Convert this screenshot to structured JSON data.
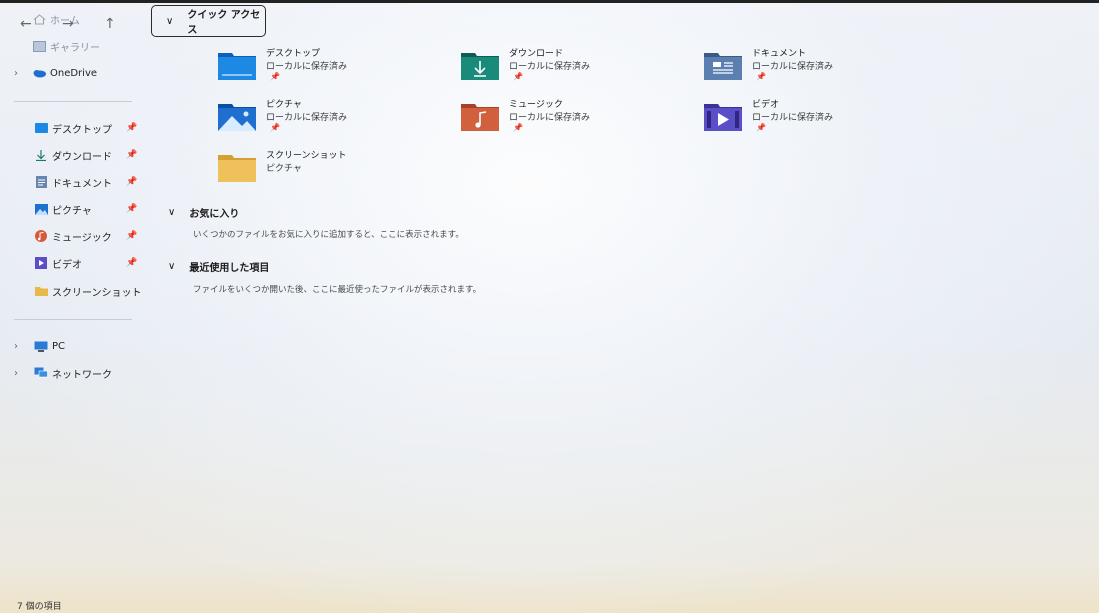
{
  "sidebar": {
    "home": "ホーム",
    "gallery": "ギャラリー",
    "onedrive": "OneDrive",
    "pinned": [
      {
        "label": "デスクトップ",
        "icon": "desktop-folder-icon",
        "pinned": true
      },
      {
        "label": "ダウンロード",
        "icon": "download-icon",
        "pinned": true
      },
      {
        "label": "ドキュメント",
        "icon": "document-icon",
        "pinned": true
      },
      {
        "label": "ピクチャ",
        "icon": "pictures-icon",
        "pinned": true
      },
      {
        "label": "ミュージック",
        "icon": "music-icon",
        "pinned": true
      },
      {
        "label": "ビデオ",
        "icon": "video-icon",
        "pinned": true
      },
      {
        "label": "スクリーンショット",
        "icon": "folder-icon",
        "pinned": false
      }
    ],
    "pc": "PC",
    "network": "ネットワーク"
  },
  "quick_access": {
    "title": "クイック アクセス",
    "items": [
      {
        "name": "デスクトップ",
        "location": "ローカルに保存済み",
        "pinned": true,
        "icon": "desktop-folder-icon",
        "color": "#1e88e5"
      },
      {
        "name": "ダウンロード",
        "location": "ローカルに保存済み",
        "pinned": true,
        "icon": "download-folder-icon",
        "color": "#1a8a7a"
      },
      {
        "name": "ドキュメント",
        "location": "ローカルに保存済み",
        "pinned": true,
        "icon": "documents-folder-icon",
        "color": "#5a7fb0"
      },
      {
        "name": "ピクチャ",
        "location": "ローカルに保存済み",
        "pinned": true,
        "icon": "pictures-folder-icon",
        "color": "#1f6fd0"
      },
      {
        "name": "ミュージック",
        "location": "ローカルに保存済み",
        "pinned": true,
        "icon": "music-folder-icon",
        "color": "#d0603e"
      },
      {
        "name": "ビデオ",
        "location": "ローカルに保存済み",
        "pinned": true,
        "icon": "videos-folder-icon",
        "color": "#5b4fc8"
      },
      {
        "name": "スクリーンショット",
        "location": "ピクチャ",
        "pinned": false,
        "icon": "folder-icon",
        "color": "#e8b84a"
      }
    ]
  },
  "favorites": {
    "title": "お気に入り",
    "description": "いくつかのファイルをお気に入りに追加すると、ここに表示されます。"
  },
  "recent": {
    "title": "最近使用した項目",
    "description": "ファイルをいくつか開いた後、ここに最近使ったファイルが表示されます。"
  },
  "status": {
    "item_count": "7 個の項目"
  }
}
